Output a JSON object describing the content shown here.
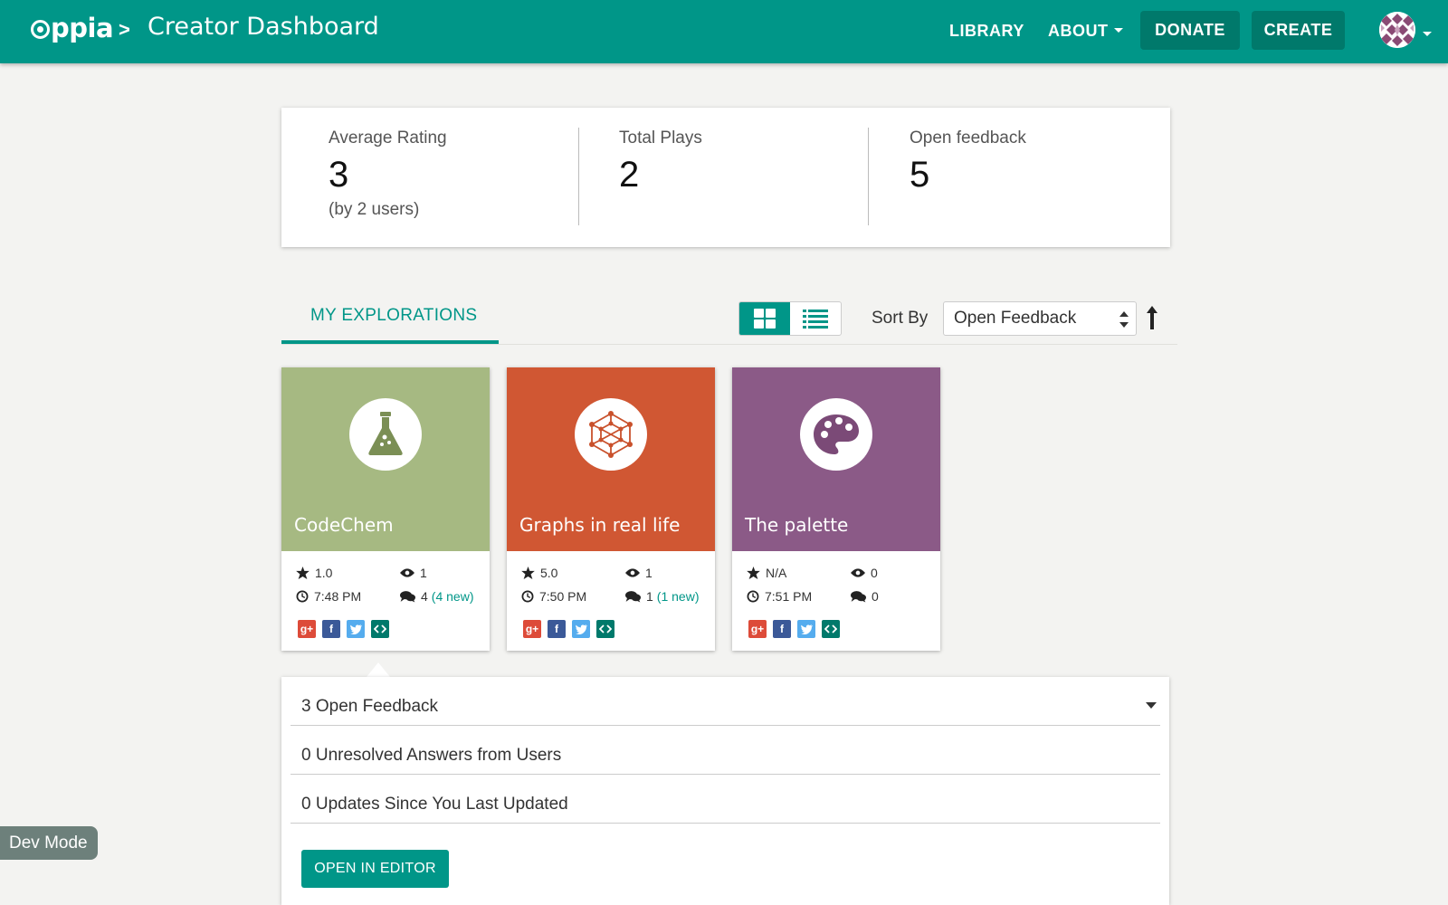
{
  "header": {
    "logo_text": "ppia",
    "breadcrumb_separator": ">",
    "page_title": "Creator Dashboard",
    "nav_library": "LIBRARY",
    "nav_about": "ABOUT",
    "donate_label": "DONATE",
    "create_label": "CREATE",
    "icons": [
      "oppia-logo-icon",
      "chevron-down-icon",
      "avatar",
      "chevron-down-icon"
    ]
  },
  "stats": {
    "average_rating": {
      "label": "Average Rating",
      "value": "3",
      "sub": "(by 2 users)"
    },
    "total_plays": {
      "label": "Total Plays",
      "value": "2"
    },
    "open_feedback": {
      "label": "Open feedback",
      "value": "5"
    }
  },
  "explorations": {
    "tab_label": "MY EXPLORATIONS",
    "sort_label": "Sort By",
    "sort_value": "Open Feedback",
    "view_icons": [
      "grid-view-icon",
      "list-view-icon",
      "sort-ascending-icon"
    ],
    "cards": [
      {
        "title": "CodeChem",
        "color": "#a6b982",
        "icon": "flask-icon",
        "rating": "1.0",
        "views": "1",
        "time": "7:48 PM",
        "feedback": "4",
        "new_feedback": "(4 new)"
      },
      {
        "title": "Graphs in real life",
        "color": "#d05733",
        "icon": "graph-network-icon",
        "rating": "5.0",
        "views": "1",
        "time": "7:50 PM",
        "feedback": "1",
        "new_feedback": "(1 new)"
      },
      {
        "title": "The palette",
        "color": "#8b5a87",
        "icon": "palette-icon",
        "rating": "N/A",
        "views": "0",
        "time": "7:51 PM",
        "feedback": "0",
        "new_feedback": ""
      }
    ],
    "share_icons": [
      "google-plus-icon",
      "facebook-icon",
      "twitter-icon",
      "embed-icon"
    ]
  },
  "feedback_panel": {
    "open_feedback": "3 Open Feedback",
    "unresolved_answers": "0 Unresolved Answers from Users",
    "updates": "0 Updates Since You Last Updated",
    "open_in_editor": "OPEN IN EDITOR"
  },
  "dev_mode": "Dev Mode",
  "colors": {
    "accent": "#009688",
    "accent_dark": "#00796b",
    "background": "#f3f3f1"
  }
}
